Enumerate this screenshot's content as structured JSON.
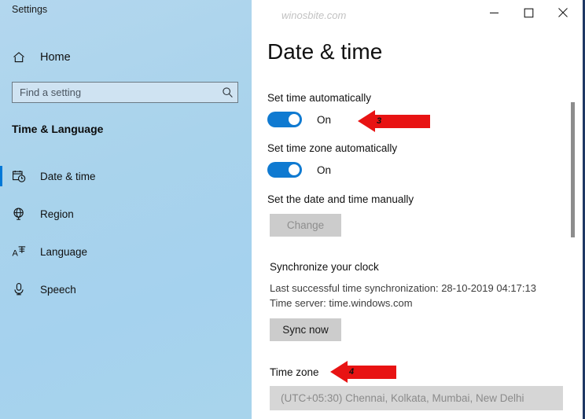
{
  "sidebar": {
    "title": "Settings",
    "home": {
      "label": "Home",
      "icon": "home-icon"
    },
    "search": {
      "value": "",
      "placeholder": "Find a setting",
      "icon": "search-icon"
    },
    "section_heading": "Time & Language",
    "items": [
      {
        "label": "Date & time",
        "icon": "calendar-clock-icon",
        "selected": true
      },
      {
        "label": "Region",
        "icon": "globe-icon",
        "selected": false
      },
      {
        "label": "Language",
        "icon": "language-icon",
        "selected": false
      },
      {
        "label": "Speech",
        "icon": "microphone-icon",
        "selected": false
      }
    ]
  },
  "titlebar": {
    "watermark": "winosbite.com",
    "minimize": "minimize-icon",
    "maximize": "maximize-icon",
    "close": "close-icon"
  },
  "main": {
    "page_title": "Date & time",
    "set_time_automatically": {
      "label": "Set time automatically",
      "state": "On"
    },
    "set_timezone_automatically": {
      "label": "Set time zone automatically",
      "state": "On"
    },
    "manual": {
      "label": "Set the date and time manually",
      "button": "Change"
    },
    "synchronize": {
      "heading": "Synchronize your clock",
      "last_sync": "Last successful time synchronization: 28-10-2019 04:17:13",
      "time_server": "Time server: time.windows.com",
      "button": "Sync now"
    },
    "timezone": {
      "label": "Time zone",
      "value": "(UTC+05:30) Chennai, Kolkata, Mumbai, New Delhi"
    }
  },
  "annotations": [
    {
      "number": "3"
    },
    {
      "number": "4"
    }
  ],
  "colors": {
    "accent": "#0078d7",
    "toggle_on": "#0f7ad1",
    "sidebar": "#a9d3ec",
    "annotation_red": "#e81313",
    "window_border": "#1f3864"
  }
}
